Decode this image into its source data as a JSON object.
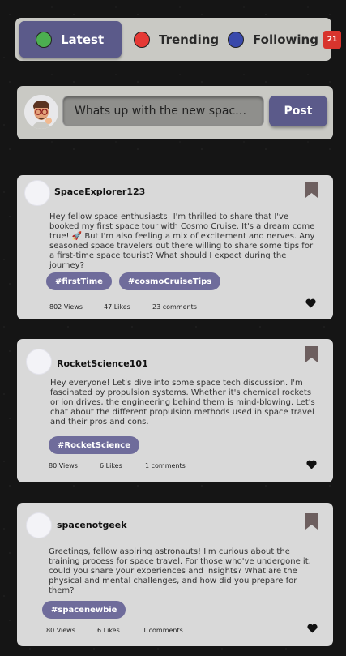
{
  "nav": {
    "tabs": [
      {
        "label": "Latest",
        "dot_color": "#4caf50"
      },
      {
        "label": "Trending",
        "dot_color": "#e53935"
      },
      {
        "label": "Following",
        "dot_color": "#3949ab",
        "badge": "21"
      }
    ]
  },
  "composer": {
    "placeholder": "Whats up with the new space st..",
    "post_label": "Post"
  },
  "posts": [
    {
      "username": "SpaceExplorer123",
      "text": "Hey fellow space enthusiasts! I'm thrilled to share that I've booked my first space tour with Cosmo Cruise. It's a dream come true! 🚀 But I'm also feeling a mix of excitement and nerves. Any seasoned space travelers out there willing to share some tips for a first-time space tourist? What should I expect during the journey?",
      "tags": [
        "#firstTime",
        "#cosmoCruiseTips"
      ],
      "views": "802 Views",
      "likes": "47 Likes",
      "comments": "23 comments"
    },
    {
      "username": "RocketScience101",
      "text": "Hey everyone! Let's dive into some space tech discussion. I'm fascinated by propulsion systems. Whether it's chemical rockets or ion drives, the engineering behind them is mind-blowing. Let's chat about the different propulsion methods used in space travel and their pros and cons.",
      "tags": [
        "#RocketScience"
      ],
      "views": "80 Views",
      "likes": "6 Likes",
      "comments": "1 comments"
    },
    {
      "username": "spacenotgeek",
      "text": "Greetings, fellow aspiring astronauts! I'm curious about the training process for space travel. For those who've undergone it, could you share your experiences and insights? What are the physical and mental challenges, and how did you prepare for them?",
      "tags": [
        "#spacenewbie"
      ],
      "views": "80 Views",
      "likes": "6 Likes",
      "comments": "1 comments"
    }
  ],
  "colors": {
    "accent": "#5b5a8a",
    "tag": "#6f6c9b",
    "badge": "#d8342d",
    "card": "#d9d9d9",
    "panel": "#c9c9c4"
  }
}
